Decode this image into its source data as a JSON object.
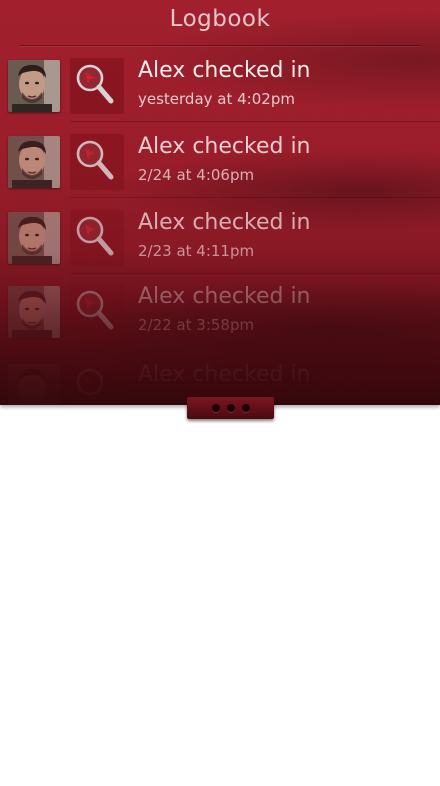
{
  "header": {
    "title": "Logbook"
  },
  "entries": [
    {
      "headline": "Alex checked in",
      "timestamp": "yesterday at 4:02pm",
      "avatar_icon": "profile-photo",
      "action_icon": "magnifier-location-icon"
    },
    {
      "headline": "Alex checked in",
      "timestamp": "2/24 at 4:06pm",
      "avatar_icon": "profile-photo",
      "action_icon": "magnifier-location-icon"
    },
    {
      "headline": "Alex checked in",
      "timestamp": "2/23 at 4:11pm",
      "avatar_icon": "profile-photo",
      "action_icon": "magnifier-location-icon"
    },
    {
      "headline": "Alex checked in",
      "timestamp": "2/22 at 3:58pm",
      "avatar_icon": "profile-photo",
      "action_icon": "magnifier-location-icon"
    },
    {
      "headline": "Alex checked in",
      "timestamp": "",
      "avatar_icon": "profile-photo",
      "action_icon": "magnifier-location-icon"
    }
  ],
  "colors": {
    "panel": "#9c1b29",
    "panel_dark": "#3e0a10",
    "title_text": "#e4c6c9",
    "headline_text": "#f7eced",
    "timestamp_text": "#e6c9cb",
    "pointer_accent": "#d0202e"
  },
  "handle": {
    "icon": "ellipsis-handle-icon",
    "dot_count": 3
  }
}
